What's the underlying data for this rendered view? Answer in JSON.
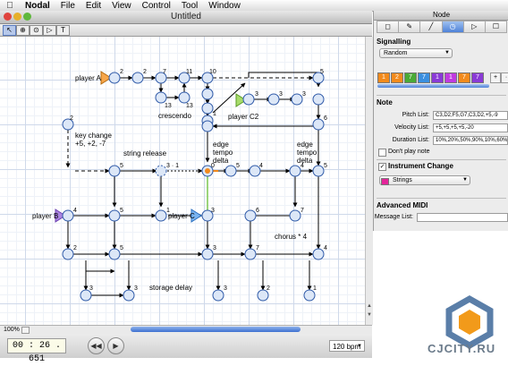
{
  "menu": {
    "items": [
      "Nodal",
      "File",
      "Edit",
      "View",
      "Control",
      "Tool",
      "Window"
    ]
  },
  "document": {
    "title": "Untitled",
    "tools": [
      "↖",
      "⊕",
      "⊙",
      "▷",
      "T"
    ],
    "zoom": "100%",
    "timer": "00 : 26 . 651",
    "bpm": "120 bpm"
  },
  "graph": {
    "labels": [
      "player A",
      "player B",
      "player C",
      "player C2",
      "crescendo",
      "string release",
      "storage delay",
      "chorus * 4",
      "key change",
      "+5, +2, -7",
      "edge",
      "tempo",
      "delta",
      "edge",
      "tempo",
      "delta"
    ]
  },
  "inspector": {
    "title": "Node",
    "tabs": [
      "◻",
      "✎",
      "╱",
      "◷",
      "▷",
      "☐"
    ],
    "signalling_label": "Signalling",
    "signalling_value": "Random",
    "channels": [
      {
        "n": "1",
        "color": "#f28a1c"
      },
      {
        "n": "2",
        "color": "#f28a1c"
      },
      {
        "n": "7",
        "color": "#4aaa36"
      },
      {
        "n": "7",
        "color": "#3a8fe0"
      },
      {
        "n": "1",
        "color": "#8a3ad6"
      },
      {
        "n": "1",
        "color": "#c03ae0"
      },
      {
        "n": "7",
        "color": "#f28a1c"
      },
      {
        "n": "7",
        "color": "#8a3ad6"
      }
    ],
    "note_label": "Note",
    "pitch_label": "Pitch List:",
    "pitch_value": "C3,D2,F5,G7,C3,D2,+5,-9",
    "velocity_label": "Velocity List:",
    "velocity_value": "+5,+5,+5,+5,-20",
    "duration_label": "Duration List:",
    "duration_value": "10%,20%,50%,90%,10%,60%",
    "dont_play_label": "Don't play note",
    "instrument_change_label": "Instrument Change",
    "instrument_value": "Strings",
    "advanced_label": "Advanced MIDI",
    "message_label": "Message List:"
  },
  "watermark": "CJCITY.RU"
}
